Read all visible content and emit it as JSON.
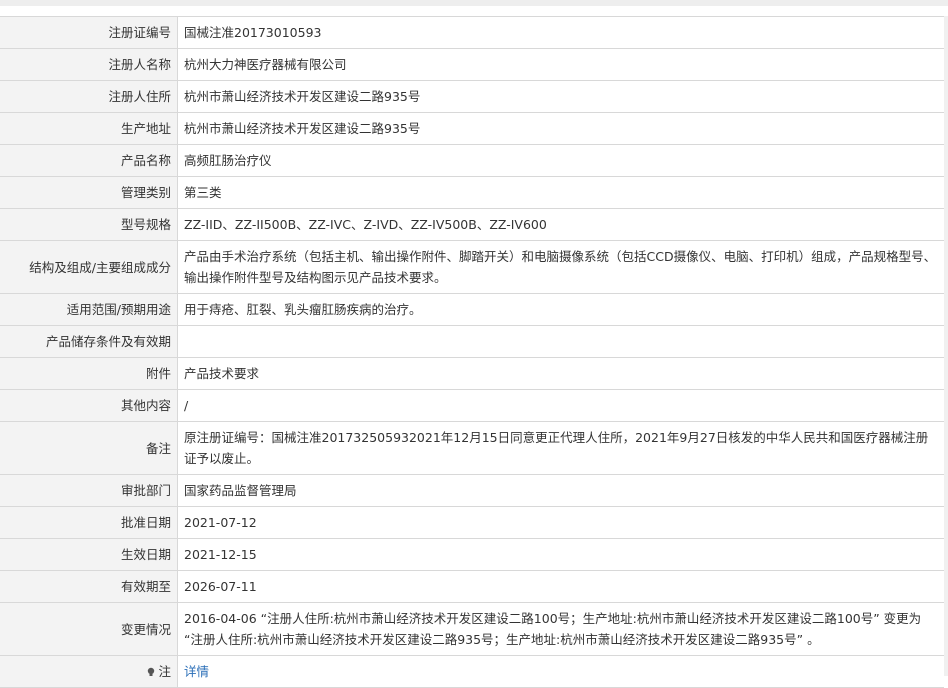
{
  "rows": [
    {
      "label": "注册证编号",
      "value": "国械注准20173010593"
    },
    {
      "label": "注册人名称",
      "value": "杭州大力神医疗器械有限公司"
    },
    {
      "label": "注册人住所",
      "value": "杭州市萧山经济技术开发区建设二路935号"
    },
    {
      "label": "生产地址",
      "value": "杭州市萧山经济技术开发区建设二路935号"
    },
    {
      "label": "产品名称",
      "value": "高频肛肠治疗仪"
    },
    {
      "label": "管理类别",
      "value": "第三类"
    },
    {
      "label": "型号规格",
      "value": "ZZ-IID、ZZ-II500B、ZZ-IVC、Z-IVD、ZZ-IV500B、ZZ-IV600"
    },
    {
      "label": "结构及组成/主要组成成分",
      "value": "产品由手术治疗系统（包括主机、输出操作附件、脚踏开关）和电脑摄像系统（包括CCD摄像仪、电脑、打印机）组成，产品规格型号、输出操作附件型号及结构图示见产品技术要求。"
    },
    {
      "label": "适用范围/预期用途",
      "value": "用于痔疮、肛裂、乳头瘤肛肠疾病的治疗。"
    },
    {
      "label": "产品储存条件及有效期",
      "value": ""
    },
    {
      "label": "附件",
      "value": "产品技术要求"
    },
    {
      "label": "其他内容",
      "value": "/"
    },
    {
      "label": "备注",
      "value": "原注册证编号：国械注准201732505932021年12月15日同意更正代理人住所，2021年9月27日核发的中华人民共和国医疗器械注册证予以废止。"
    },
    {
      "label": "审批部门",
      "value": "国家药品监督管理局"
    },
    {
      "label": "批准日期",
      "value": "2021-07-12"
    },
    {
      "label": "生效日期",
      "value": "2021-12-15"
    },
    {
      "label": "有效期至",
      "value": "2026-07-11"
    },
    {
      "label": "变更情况",
      "value": "2016-04-06 “注册人住所:杭州市萧山经济技术开发区建设二路100号；生产地址:杭州市萧山经济技术开发区建设二路100号” 变更为 “注册人住所:杭州市萧山经济技术开发区建设二路935号；生产地址:杭州市萧山经济技术开发区建设二路935号” 。"
    }
  ],
  "note": {
    "label": "注",
    "link_text": "详情",
    "icon": "lightbulb-icon"
  }
}
